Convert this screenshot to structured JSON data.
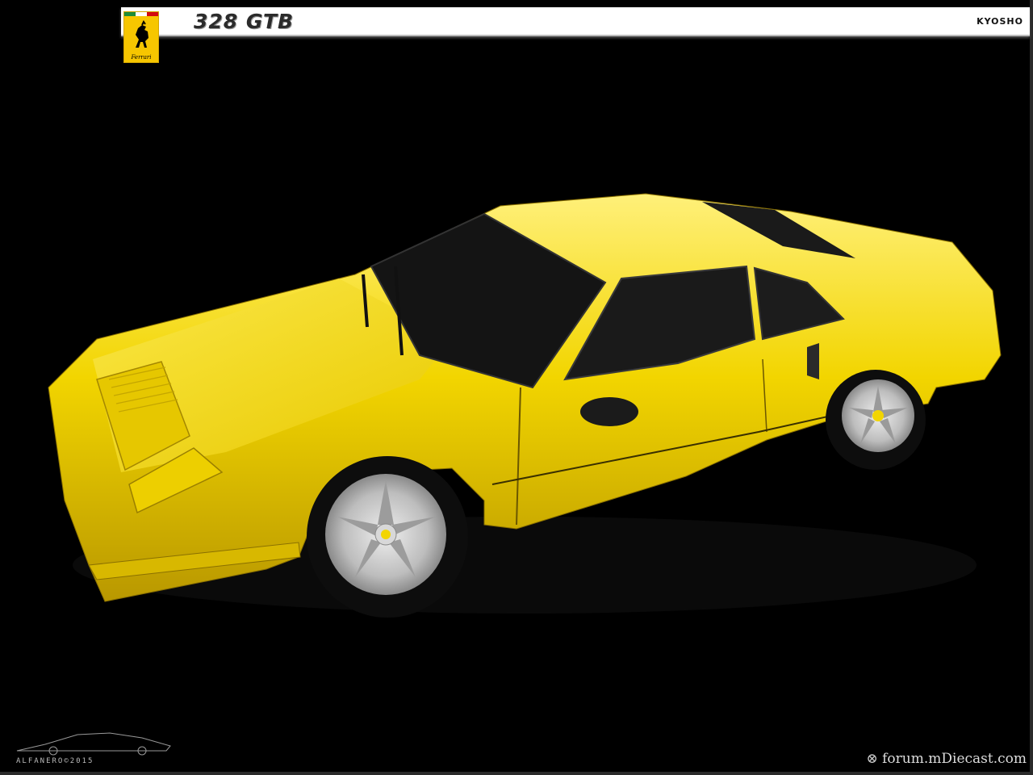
{
  "header": {
    "title": "328 GTB",
    "brand": "KYOSHO"
  },
  "logo": {
    "icon": "prancing-horse-icon",
    "word": "Ferrari",
    "background_color": "#f7c600"
  },
  "footer": {
    "left_text": "ALFANERO©2015",
    "right_text": "forum.mDiecast.com"
  },
  "colors": {
    "car_body": "#f2d500",
    "background": "#000000"
  }
}
